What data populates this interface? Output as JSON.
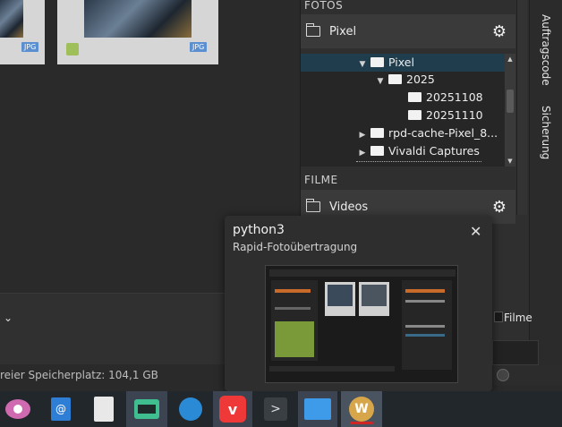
{
  "thumbnails": [
    {
      "badge": "JPG"
    },
    {
      "badge": "JPG"
    }
  ],
  "status": {
    "free_space": "reier Speicherplatz: 104,1 GB"
  },
  "photos_section": {
    "header": "FOTOS",
    "folder": "Pixel"
  },
  "tree": {
    "items": [
      {
        "label": "Pixel",
        "level": 0,
        "expanded": true,
        "selected": true
      },
      {
        "label": "2025",
        "level": 1,
        "expanded": true
      },
      {
        "label": "20251108",
        "level": 2
      },
      {
        "label": "20251110",
        "level": 2
      },
      {
        "label": "rpd-cache-Pixel_8...",
        "level": 0,
        "expanded": false
      },
      {
        "label": "Vivaldi Captures",
        "level": 0,
        "expanded": false
      }
    ]
  },
  "videos_section": {
    "header": "FILME",
    "folder": "Videos"
  },
  "side_tabs": [
    "Auftragscode",
    "Sicherung"
  ],
  "filter": {
    "filme_label": "Filme"
  },
  "popup": {
    "title": "python3",
    "subtitle": "Rapid-Fotoübertragung",
    "close": "✕"
  },
  "taskbar": {
    "items": [
      {
        "name": "eye-app-icon"
      },
      {
        "name": "mail-app-icon"
      },
      {
        "name": "document-app-icon"
      },
      {
        "name": "audio-app-icon"
      },
      {
        "name": "bird-app-icon"
      },
      {
        "name": "vivaldi-app-icon"
      },
      {
        "name": "terminal-app-icon"
      },
      {
        "name": "files-app-icon"
      },
      {
        "name": "rapid-photo-downloader-icon",
        "active": true
      }
    ],
    "active_color": "#d02525"
  }
}
